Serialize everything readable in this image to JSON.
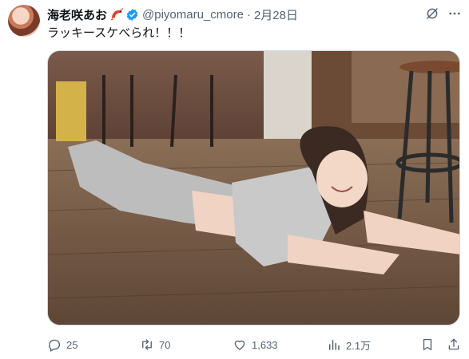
{
  "tweet": {
    "author": {
      "display_name": "海老咲あお",
      "handle": "@piyomaru_cmore",
      "verified": true
    },
    "separator": "·",
    "timestamp": "2月28日",
    "text": "ラッキースケべられ！！！",
    "stats": {
      "replies": "25",
      "retweets": "70",
      "likes": "1,633",
      "views": "2.1万"
    }
  },
  "icons": {
    "avatar": "avatar",
    "shrimp": "shrimp-emoji-icon",
    "verified": "verified-badge-icon",
    "grok": "grok-icon",
    "more": "more-options-icon",
    "reply": "reply-icon",
    "retweet": "retweet-icon",
    "like": "heart-icon",
    "views": "analytics-icon",
    "bookmark": "bookmark-icon",
    "share": "share-icon"
  },
  "colors": {
    "verified_blue": "#1d9bf0",
    "text_primary": "#0f1419",
    "text_secondary": "#536471",
    "border": "#cfd9de"
  }
}
